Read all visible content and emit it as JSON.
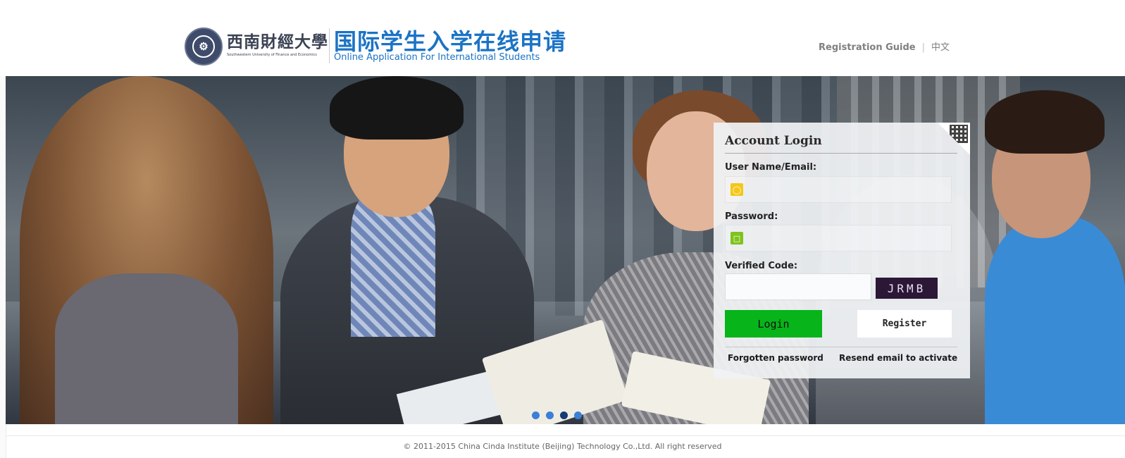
{
  "header": {
    "uni_name_cn": "西南財經大學",
    "uni_name_en": "Southwestern University of Finance and Economics",
    "app_title_cn": "国际学生入学在线申请",
    "app_title_en": "Online Application For International Students",
    "nav": {
      "guide": "Registration Guide",
      "separator": "|",
      "language": "中文"
    }
  },
  "banner": {
    "slides": 4,
    "active_slide": 3
  },
  "login": {
    "title": "Account Login",
    "username_label": "User Name/Email:",
    "password_label": "Password:",
    "code_label": "Verified Code:",
    "captcha_text": "JRMB",
    "login_button": "Login",
    "register_button": "Register",
    "forgot_link": "Forgotten password",
    "resend_link": "Resend email to activate"
  },
  "footer": {
    "copyright": "© 2011-2015 China Cinda Institute (Beijing) Technology Co.,Ltd. All right reserved"
  },
  "colors": {
    "brand_blue": "#1b73c5",
    "login_green": "#07b41a",
    "user_icon": "#f4c718",
    "lock_icon": "#7fc31c",
    "dot": "#3b7fd6",
    "dot_active": "#163a73"
  },
  "icons": [
    "university-seal-icon",
    "user-icon",
    "lock-icon",
    "qr-code-icon"
  ]
}
